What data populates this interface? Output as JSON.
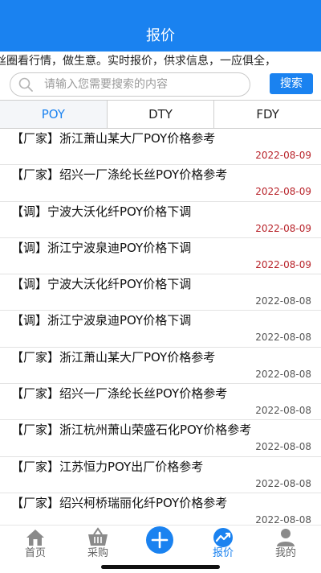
{
  "header": {
    "title": "报价"
  },
  "marquee": {
    "text": "丝圈看行情，做生意。实时报价，供求信息，一应俱全，"
  },
  "search": {
    "placeholder": "请输入您需要搜索的内容",
    "value": "",
    "button_label": "搜索"
  },
  "tabs": [
    {
      "label": "POY",
      "active": true
    },
    {
      "label": "DTY",
      "active": false
    },
    {
      "label": "FDY",
      "active": false
    }
  ],
  "items": [
    {
      "title": "【厂家】浙江萧山某大厂POY价格参考",
      "date": "2022-08-09"
    },
    {
      "title": "【厂家】绍兴一厂涤纶长丝POY价格参考",
      "date": "2022-08-09"
    },
    {
      "title": "【调】宁波大沃化纤POY价格下调",
      "date": "2022-08-09"
    },
    {
      "title": "【调】浙江宁波泉迪POY价格下调",
      "date": "2022-08-09"
    },
    {
      "title": "【调】宁波大沃化纤POY价格下调",
      "date": "2022-08-08"
    },
    {
      "title": "【调】浙江宁波泉迪POY价格下调",
      "date": "2022-08-08"
    },
    {
      "title": "【厂家】浙江萧山某大厂POY价格参考",
      "date": "2022-08-08"
    },
    {
      "title": "【厂家】绍兴一厂涤纶长丝POY价格参考",
      "date": "2022-08-08"
    },
    {
      "title": "【厂家】浙江杭州萧山荣盛石化POY价格参考",
      "date": "2022-08-08"
    },
    {
      "title": "【厂家】江苏恒力POY出厂价格参考",
      "date": "2022-08-08"
    },
    {
      "title": "【厂家】绍兴柯桥瑞丽化纤POY价格参考",
      "date": "2022-08-08"
    }
  ],
  "tabbar": [
    {
      "label": "首页",
      "icon": "home-icon"
    },
    {
      "label": "采购",
      "icon": "basket-icon"
    },
    {
      "label": "",
      "icon": "plus-icon"
    },
    {
      "label": "报价",
      "icon": "trend-icon",
      "active": true
    },
    {
      "label": "我的",
      "icon": "user-icon"
    }
  ],
  "colors": {
    "accent": "#1a82f0",
    "date_recent": "#b8232a",
    "date_older": "#555555"
  }
}
